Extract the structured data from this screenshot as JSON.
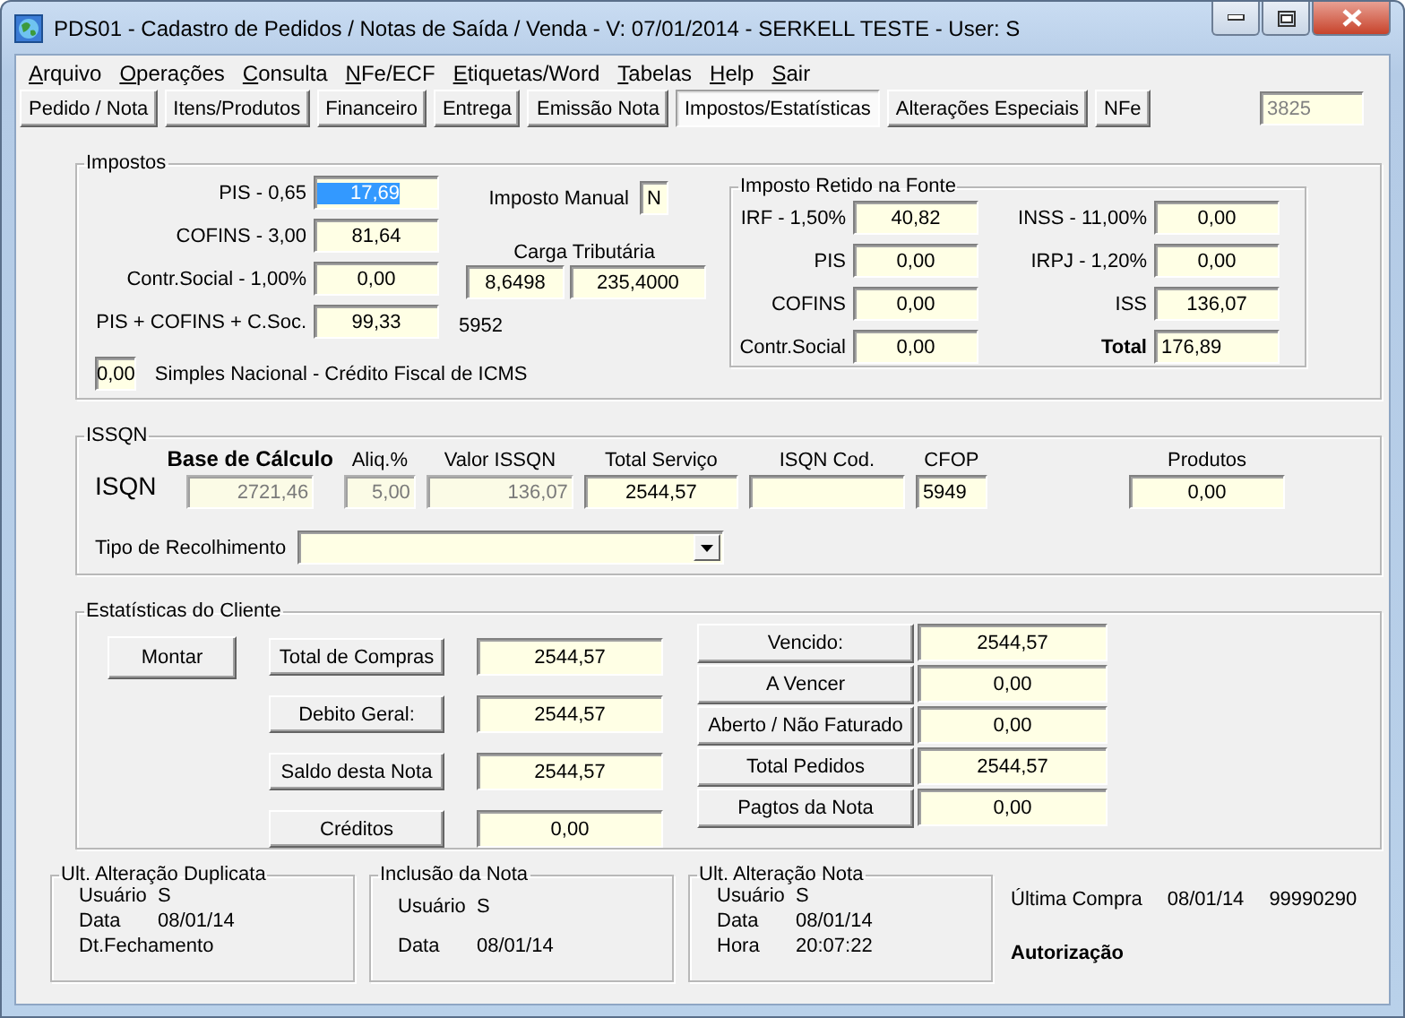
{
  "window": {
    "title": "PDS01 - Cadastro de Pedidos / Notas de Saída / Venda - V: 07/01/2014 - SERKELL TESTE - User: S"
  },
  "menu": [
    "Arquivo",
    "Operações",
    "Consulta",
    "NFe/ECF",
    "Etiquetas/Word",
    "Tabelas",
    "Help",
    "Sair"
  ],
  "tabs": [
    {
      "label": "Pedido / Nota",
      "selected": false
    },
    {
      "label": "Itens/Produtos",
      "selected": false
    },
    {
      "label": "Financeiro",
      "selected": false
    },
    {
      "label": "Entrega",
      "selected": false
    },
    {
      "label": "Emissão Nota",
      "selected": false
    },
    {
      "label": "Impostos/Estatísticas",
      "selected": true
    },
    {
      "label": "Alterações Especiais",
      "selected": false
    },
    {
      "label": "NFe",
      "selected": false
    }
  ],
  "order_number": "3825",
  "impostos": {
    "title": "Impostos",
    "rows": [
      {
        "label": "PIS - 0,65",
        "value": "17,69",
        "selected": true
      },
      {
        "label": "COFINS - 3,00",
        "value": "81,64",
        "selected": false
      },
      {
        "label": "Contr.Social - 1,00%",
        "value": "0,00",
        "selected": false
      },
      {
        "label": "PIS + COFINS + C.Soc.",
        "value": "99,33",
        "selected": false
      }
    ],
    "manual": {
      "label": "Imposto Manual",
      "value": "N"
    },
    "carga": {
      "label": "Carga Tributária",
      "values": [
        "8,6498",
        "235,4000"
      ]
    },
    "sum_code": "5952",
    "simples": {
      "value": "0,00",
      "label": "Simples Nacional - Crédito Fiscal de ICMS"
    }
  },
  "retido": {
    "title": "Imposto Retido na Fonte",
    "rows": [
      {
        "label": "IRF - 1,50%",
        "value": "40,82",
        "kind": "plain"
      },
      {
        "label": "INSS - 11,00%",
        "value": "0,00",
        "kind": "plain"
      },
      {
        "label": "PIS",
        "value": "0,00",
        "kind": "plain"
      },
      {
        "label": "IRPJ - 1,20%",
        "value": "0,00",
        "kind": "plain"
      },
      {
        "label": "COFINS",
        "value": "0,00",
        "kind": "plain"
      },
      {
        "label": "ISS",
        "value": "136,07",
        "kind": "plain"
      },
      {
        "label": "Contr.Social",
        "value": "0,00",
        "kind": "plain"
      },
      {
        "label": "Total",
        "value": "176,89",
        "kind": "total"
      }
    ]
  },
  "issqn": {
    "title": "ISSQN",
    "row_label": "ISQN",
    "columns": [
      {
        "heading": "Base de Cálculo",
        "value": "2721,46",
        "disabled": true,
        "kind": "key"
      },
      {
        "heading": "Aliq.%",
        "value": "5,00",
        "disabled": true,
        "kind": "plain"
      },
      {
        "heading": "Valor ISSQN",
        "value": "136,07",
        "disabled": true,
        "kind": "plain"
      },
      {
        "heading": "Total Serviço",
        "value": "2544,57",
        "disabled": false,
        "kind": "plain"
      },
      {
        "heading": "ISQN Cod.",
        "disabled": false,
        "kind": "plain"
      },
      {
        "heading": "CFOP",
        "value": "5949",
        "disabled": false,
        "kind": "code"
      }
    ],
    "produtos": {
      "heading": "Produtos",
      "value": "0,00"
    },
    "tipo_label": "Tipo de Recolhimento"
  },
  "estatisticas": {
    "title": "Estatísticas do Cliente",
    "montar": "Montar",
    "left": [
      {
        "label": "Total de Compras",
        "value": "2544,57"
      },
      {
        "label": "Debito Geral:",
        "value": "2544,57"
      },
      {
        "label": "Saldo desta Nota",
        "value": "2544,57"
      },
      {
        "label": "Créditos",
        "value": "0,00"
      }
    ],
    "right": [
      {
        "label": "Vencido:",
        "value": "2544,57"
      },
      {
        "label": "A Vencer",
        "value": "0,00"
      },
      {
        "label": "Aberto / Não Faturado",
        "value": "0,00"
      },
      {
        "label": "Total Pedidos",
        "value": "2544,57"
      },
      {
        "label": "Pagtos da Nota",
        "value": "0,00"
      }
    ]
  },
  "footer_groups": [
    {
      "title": "Ult. Alteração Duplicata",
      "lines": [
        {
          "label": "Usuário",
          "value": "S"
        },
        {
          "label": "Data",
          "value": "08/01/14"
        },
        {
          "label": "Dt.Fechamento"
        }
      ]
    },
    {
      "title": "Inclusão da Nota",
      "lines": [
        {
          "label": "Usuário",
          "value": "S"
        },
        {
          "label": "Data",
          "value": "08/01/14"
        }
      ]
    },
    {
      "title": "Ult. Alteração Nota",
      "lines": [
        {
          "label": "Usuário",
          "value": "S"
        },
        {
          "label": "Data",
          "value": "08/01/14"
        },
        {
          "label": "Hora",
          "value": "20:07:22"
        }
      ]
    }
  ],
  "last_purchase": {
    "label": "Última Compra",
    "date": "08/01/14",
    "number": "99990290"
  },
  "authorization": "Autorização"
}
